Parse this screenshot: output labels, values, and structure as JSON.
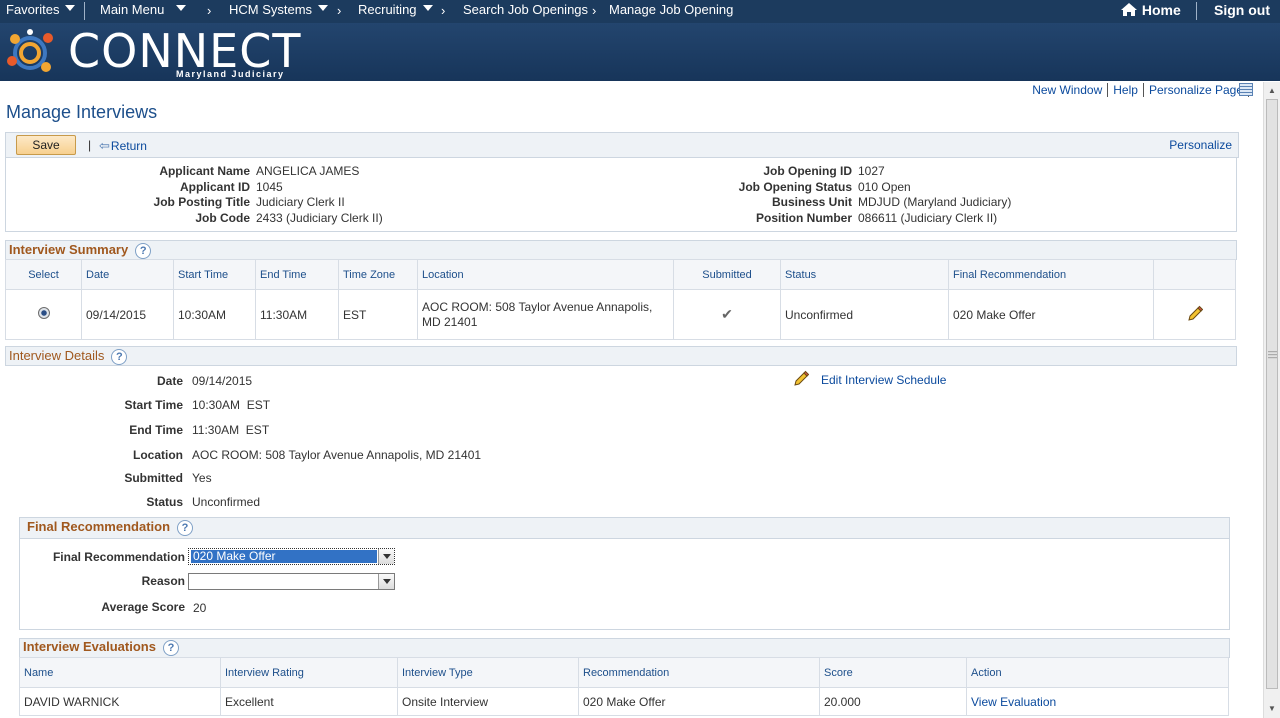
{
  "nav": {
    "favorites": "Favorites",
    "main_menu": "Main Menu",
    "crumbs": [
      "HCM Systems",
      "Recruiting",
      "Search Job Openings",
      "Manage Job Opening"
    ],
    "home": "Home",
    "signout": "Sign out"
  },
  "banner": {
    "logo": "CONNECT",
    "sub": "Maryland Judiciary"
  },
  "page_links": {
    "new_window": "New Window",
    "help": "Help",
    "personalize_page": "Personalize Page"
  },
  "page_title": "Manage Interviews",
  "toolbar": {
    "save": "Save",
    "return": "Return",
    "personalize": "Personalize"
  },
  "header": {
    "applicant_name_label": "Applicant Name",
    "applicant_name": "ANGELICA JAMES",
    "applicant_id_label": "Applicant ID",
    "applicant_id": "1045",
    "job_posting_title_label": "Job Posting Title",
    "job_posting_title": "Judiciary Clerk II",
    "job_code_label": "Job Code",
    "job_code": "2433 (Judiciary Clerk II)",
    "job_opening_id_label": "Job Opening ID",
    "job_opening_id": "1027",
    "job_opening_status_label": "Job Opening Status",
    "job_opening_status": "010 Open",
    "business_unit_label": "Business Unit",
    "business_unit": "MDJUD (Maryland Judiciary)",
    "position_number_label": "Position Number",
    "position_number": "086611 (Judiciary Clerk II)"
  },
  "interview_summary": {
    "title": "Interview Summary",
    "columns": [
      "Select",
      "Date",
      "Start Time",
      "End Time",
      "Time Zone",
      "Location",
      "Submitted",
      "Status",
      "Final Recommendation"
    ],
    "row": {
      "date": "09/14/2015",
      "start": "10:30AM",
      "end": "11:30AM",
      "tz": "EST",
      "location": "AOC ROOM: 508 Taylor Avenue Annapolis, MD 21401",
      "status": "Unconfirmed",
      "final_rec": "020 Make Offer"
    }
  },
  "interview_details": {
    "title": "Interview Details",
    "date_label": "Date",
    "date": "09/14/2015",
    "start_label": "Start Time",
    "start": "10:30AM  EST",
    "end_label": "End Time",
    "end": "11:30AM  EST",
    "location_label": "Location",
    "location": "AOC ROOM: 508 Taylor Avenue Annapolis, MD 21401",
    "submitted_label": "Submitted",
    "submitted": "Yes",
    "status_label": "Status",
    "status": "Unconfirmed",
    "edit_link": "Edit Interview Schedule"
  },
  "final_recommendation": {
    "title": "Final Recommendation",
    "rec_label": "Final Recommendation",
    "rec_value": "020 Make Offer",
    "reason_label": "Reason",
    "reason_value": "",
    "avg_label": "Average Score",
    "avg_value": "20"
  },
  "evaluations": {
    "title": "Interview Evaluations",
    "columns": [
      "Name",
      "Interview Rating",
      "Interview Type",
      "Recommendation",
      "Score",
      "Action"
    ],
    "row": {
      "name": "DAVID WARNICK",
      "rating": "Excellent",
      "type": "Onsite Interview",
      "rec": "020 Make Offer",
      "score": "20.000",
      "action": "View Evaluation"
    }
  }
}
